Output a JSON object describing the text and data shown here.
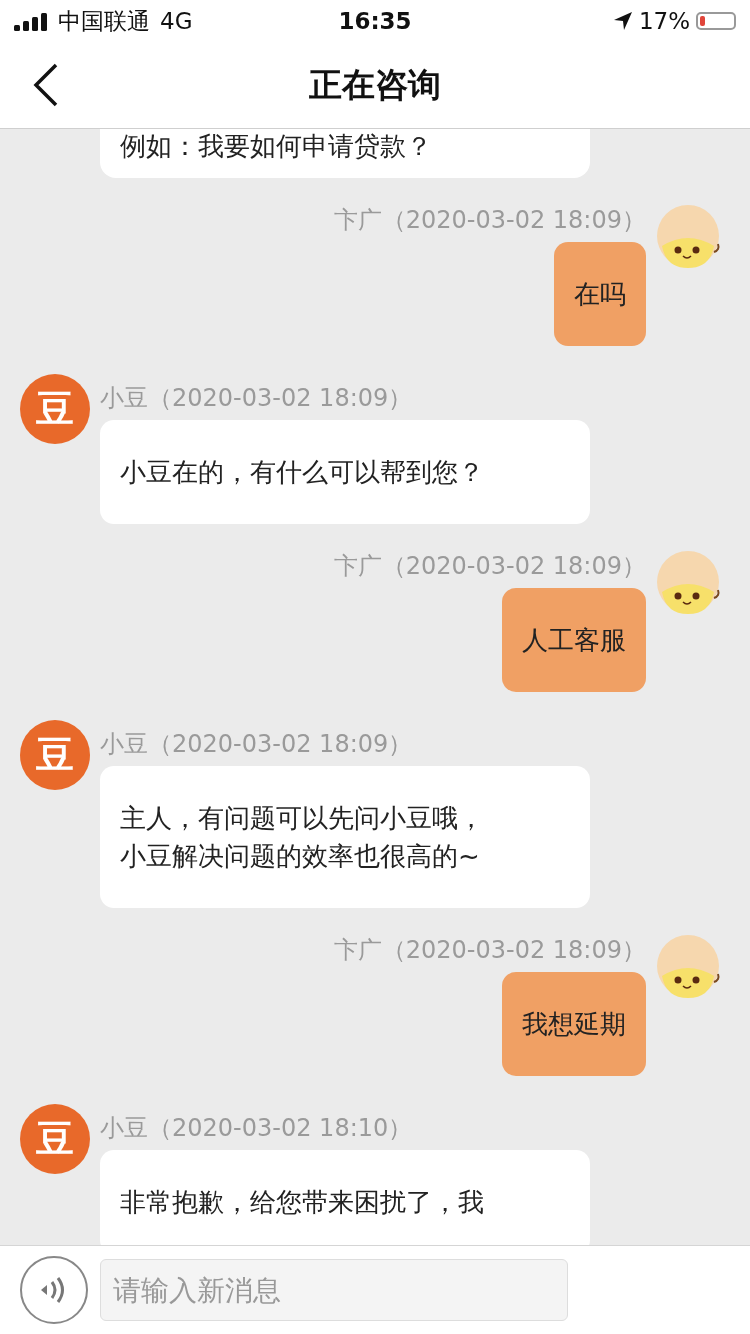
{
  "status_bar": {
    "carrier": "中国联通",
    "network": "4G",
    "time": "16:35",
    "battery_text": "17%",
    "battery": {
      "level": 0.17
    }
  },
  "nav": {
    "title": "正在咨询"
  },
  "partial_top_message": {
    "text": "例如：我要如何申请贷款？"
  },
  "messages": [
    {
      "kind": "user",
      "name": "卞广（2020-03-02 18:09）",
      "lines": [
        "在吗"
      ]
    },
    {
      "kind": "bot",
      "avatar_glyph": "豆",
      "name": "小豆（2020-03-02 18:09）",
      "lines": [
        "小豆在的，有什么可以帮到您？"
      ]
    },
    {
      "kind": "user",
      "name": "卞广（2020-03-02 18:09）",
      "lines": [
        "人工客服"
      ]
    },
    {
      "kind": "bot",
      "avatar_glyph": "豆",
      "name": "小豆（2020-03-02 18:09）",
      "lines": [
        "主人，有问题可以先问小豆哦，",
        "小豆解决问题的效率也很高的~"
      ]
    },
    {
      "kind": "user",
      "name": "卞广（2020-03-02 18:09）",
      "lines": [
        "我想延期"
      ]
    },
    {
      "kind": "bot",
      "avatar_glyph": "豆",
      "name": "小豆（2020-03-02 18:10）",
      "lines": [
        "非常抱歉，给您带来困扰了，我"
      ]
    }
  ],
  "input_bar": {
    "placeholder": "请输入新消息"
  }
}
